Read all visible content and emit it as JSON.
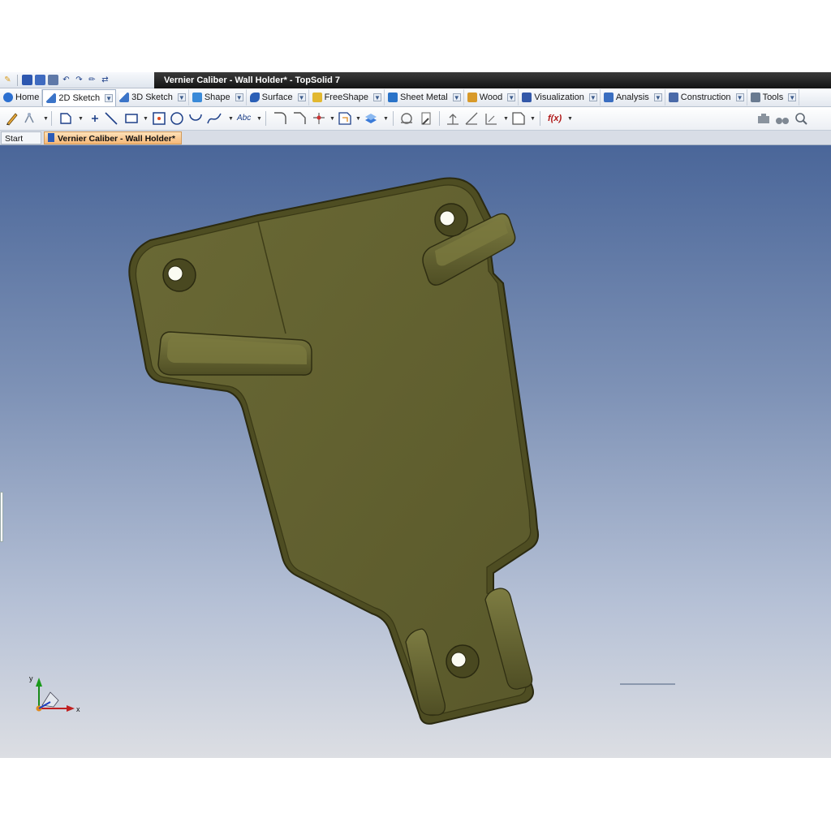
{
  "window": {
    "title": "Vernier Caliber - Wall Holder* - TopSolid 7"
  },
  "quick_access": {
    "icons": [
      "app-menu-icon",
      "save-icon",
      "save-all-icon",
      "print-icon",
      "undo-icon",
      "redo-icon",
      "pen-icon",
      "refresh-icon"
    ]
  },
  "ribbon": {
    "tabs": [
      {
        "label": "Home",
        "icon": "home-icon",
        "color": "#2b6fd0"
      },
      {
        "label": "2D Sketch",
        "icon": "2d-sketch-icon",
        "color": "#3b74c8"
      },
      {
        "label": "3D Sketch",
        "icon": "3d-sketch-icon",
        "color": "#3b74c8"
      },
      {
        "label": "Shape",
        "icon": "shape-icon",
        "color": "#3a8ad8"
      },
      {
        "label": "Surface",
        "icon": "surface-icon",
        "color": "#2a5fb6"
      },
      {
        "label": "FreeShape",
        "icon": "freeshape-icon",
        "color": "#e2b830"
      },
      {
        "label": "Sheet Metal",
        "icon": "sheet-metal-icon",
        "color": "#2a73c8"
      },
      {
        "label": "Wood",
        "icon": "wood-icon",
        "color": "#d89a2a"
      },
      {
        "label": "Visualization",
        "icon": "visualization-icon",
        "color": "#3358a8"
      },
      {
        "label": "Analysis",
        "icon": "analysis-icon",
        "color": "#3a6ec0"
      },
      {
        "label": "Construction",
        "icon": "construction-icon",
        "color": "#4a6aa8"
      },
      {
        "label": "Tools",
        "icon": "tools-icon",
        "color": "#6a7b90"
      }
    ],
    "active_tab": "2D Sketch"
  },
  "toolbar": {
    "text_tool_label": "Abc",
    "function_tool_label": "f(x)"
  },
  "document_tabs": [
    {
      "label": "Start Page"
    },
    {
      "label": "Vernier Caliber - Wall Holder*"
    }
  ],
  "viewport": {
    "part_color": "#5f5e2f",
    "triad": {
      "x_label": "x",
      "y_label": "y"
    }
  }
}
